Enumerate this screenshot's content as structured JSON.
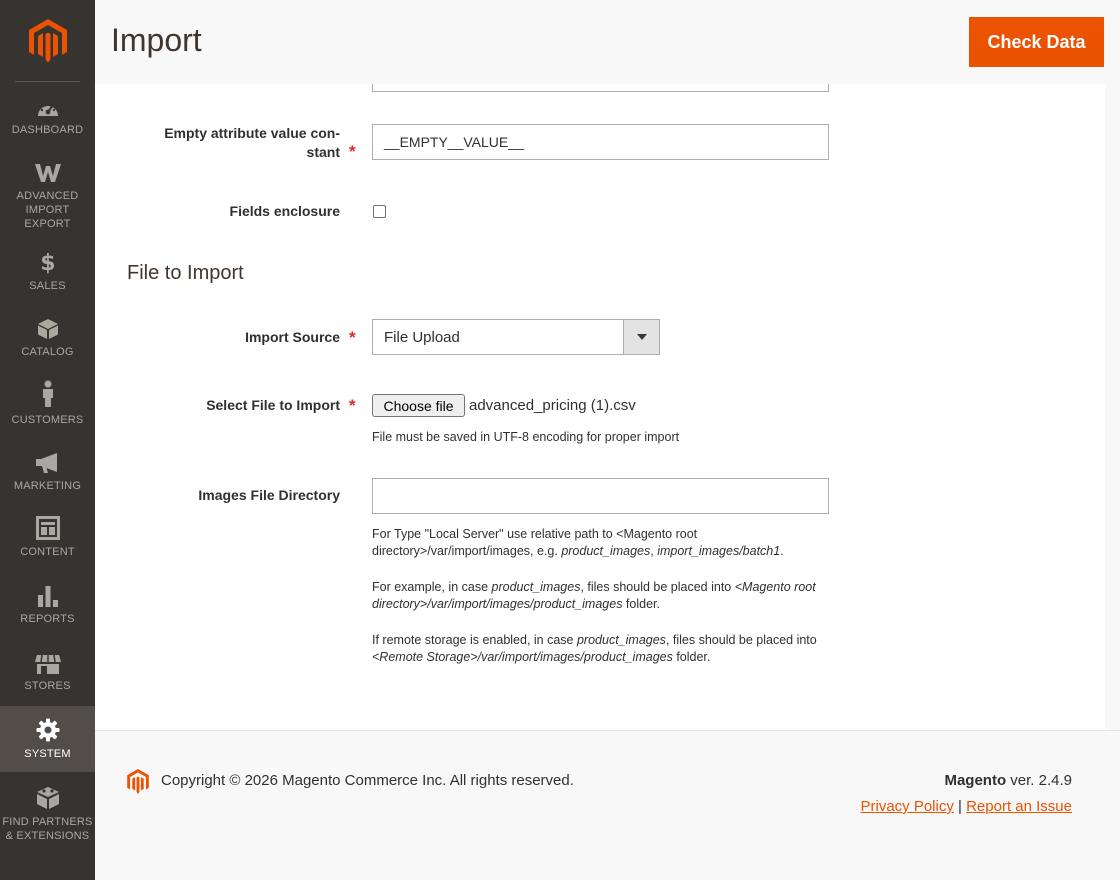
{
  "sidebar": {
    "logo_icon": "magento-logo-icon",
    "items": [
      {
        "label": "DASHBOARD",
        "icon": "dashboard-icon"
      },
      {
        "label": "ADVANCED IMPORT EXPORT",
        "line1": "ADVANCED",
        "line2": "IMPORT",
        "line3": "EXPORT",
        "icon": "w-icon"
      },
      {
        "label": "SALES",
        "icon": "dollar-icon"
      },
      {
        "label": "CATALOG",
        "icon": "box-icon"
      },
      {
        "label": "CUSTOMERS",
        "icon": "person-icon"
      },
      {
        "label": "MARKETING",
        "icon": "megaphone-icon"
      },
      {
        "label": "CONTENT",
        "icon": "layout-icon"
      },
      {
        "label": "REPORTS",
        "icon": "bar-chart-icon"
      },
      {
        "label": "STORES",
        "icon": "storefront-icon"
      },
      {
        "label": "SYSTEM",
        "icon": "gear-icon",
        "active": true
      },
      {
        "label": "FIND PARTNERS & EXTENSIONS",
        "line1": "FIND PARTNERS",
        "line2": "& EXTENSIONS",
        "icon": "blocks-icon"
      }
    ]
  },
  "header": {
    "title": "Import",
    "check_button": "Check Data"
  },
  "form": {
    "empty_attr_label_1": "Empty attribute value con-",
    "empty_attr_label_2": "stant",
    "empty_attr_value": "__EMPTY__VALUE__",
    "fields_enclosure_label": "Fields enclosure",
    "fields_enclosure_checked": false,
    "section_title": "File to Import",
    "import_source_label": "Import Source",
    "import_source_value": "File Upload",
    "select_file_label": "Select File to Import",
    "choose_file_button": "Choose file",
    "file_name": "advanced_pricing (1).csv",
    "file_note": "File must be saved in UTF-8 encoding for proper import",
    "images_dir_label": "Images File Directory",
    "images_dir_value": "",
    "required_mark": "*",
    "note1_a": "For Type \"Local Server\" use relative path to <Magento root directory>/var/import/images, e.g. ",
    "note1_b": "product_images",
    "note1_c": ", ",
    "note1_d": "import_images/batch1",
    "note1_e": ".",
    "note2_a": "For example, in case ",
    "note2_b": "product_images",
    "note2_c": ", files should be placed into ",
    "note2_d": "<Magento root directory>/var/import/images/product_images",
    "note2_e": " folder.",
    "note3_a": "If remote storage is enabled, in case ",
    "note3_b": "product_images",
    "note3_c": ", files should be placed into ",
    "note3_d": "<Remote Storage>/var/import/images/product_images",
    "note3_e": " folder."
  },
  "footer": {
    "copyright": "Copyright © 2026 Magento Commerce Inc. All rights reserved.",
    "brand": "Magento",
    "version": " ver. 2.4.9",
    "privacy_link": "Privacy Policy",
    "separator": "|",
    "report_link": "Report an Issue"
  },
  "colors": {
    "accent": "#eb5202",
    "sidebar_bg": "#373330",
    "required": "#e22626"
  }
}
